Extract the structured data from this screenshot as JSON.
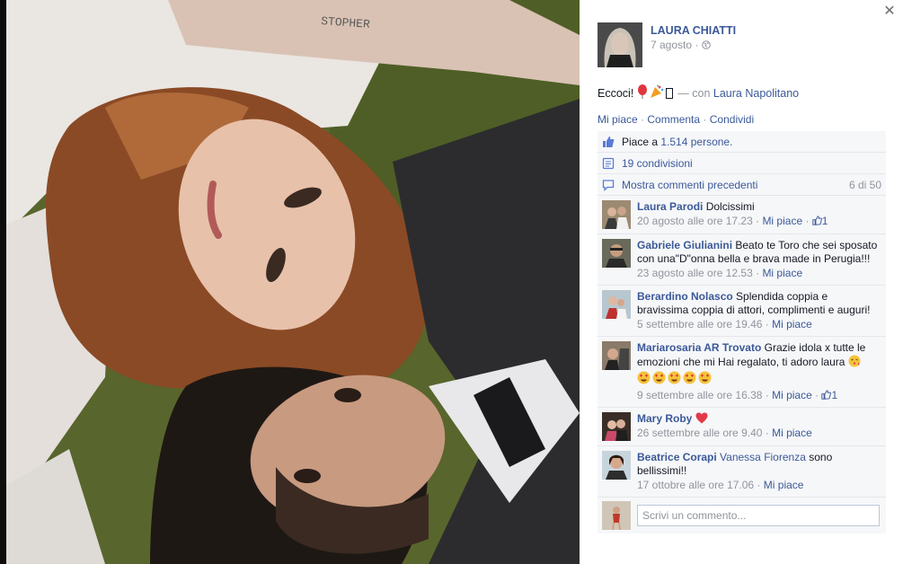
{
  "author": {
    "name": "LAURA CHIATTI",
    "date": "7 agosto",
    "privacy_sep": "·"
  },
  "post": {
    "text": "Eccoci!",
    "with_prefix": "— con",
    "with_name": "Laura Napolitano"
  },
  "photo": {
    "arm_text": "STOPHER"
  },
  "actions": {
    "like": "Mi piace",
    "comment": "Commenta",
    "share": "Condividi",
    "sep": "·"
  },
  "ufi": {
    "likes_prefix": "Piace a",
    "likes_link": "1.514 persone.",
    "shares": "19 condivisioni",
    "previous_comments": "Mostra commenti precedenti",
    "comment_count": "6 di 50"
  },
  "comments": [
    {
      "author": "Laura Parodi",
      "text": "Dolcissimi",
      "time": "20 agosto alle ore 17.23",
      "like": "Mi piace",
      "likes": "1"
    },
    {
      "author": "Gabriele Giulianini",
      "text": "Beato te Toro che sei sposato con una\"D\"onna bella e brava made in Perugia!!!",
      "time": "23 agosto alle ore 12.53",
      "like": "Mi piace",
      "likes": ""
    },
    {
      "author": "Berardino Nolasco",
      "text": "Splendida coppia e bravissima coppia di attori, complimenti e auguri!",
      "time": "5 settembre alle ore 19.46",
      "like": "Mi piace",
      "likes": ""
    },
    {
      "author": "Mariarosaria AR Trovato",
      "text": "Grazie idola x tutte le emozioni che mi Hai regalato, ti adoro laura",
      "time": "9 settembre alle ore 16.38",
      "like": "Mi piace",
      "likes": "1"
    },
    {
      "author": "Mary Roby",
      "text": "",
      "time": "26 settembre alle ore 9.40",
      "like": "Mi piace",
      "likes": ""
    },
    {
      "author": "Beatrice Corapi",
      "mention": "Vanessa Fiorenza",
      "text": "sono bellissimi!!",
      "time": "17 ottobre alle ore 17.06",
      "like": "Mi piace",
      "likes": ""
    }
  ],
  "reply": {
    "placeholder": "Scrivi un commento..."
  },
  "colors": {
    "link": "#3b5998",
    "muted": "#90949c",
    "ufi_bg": "#f6f7f9"
  }
}
